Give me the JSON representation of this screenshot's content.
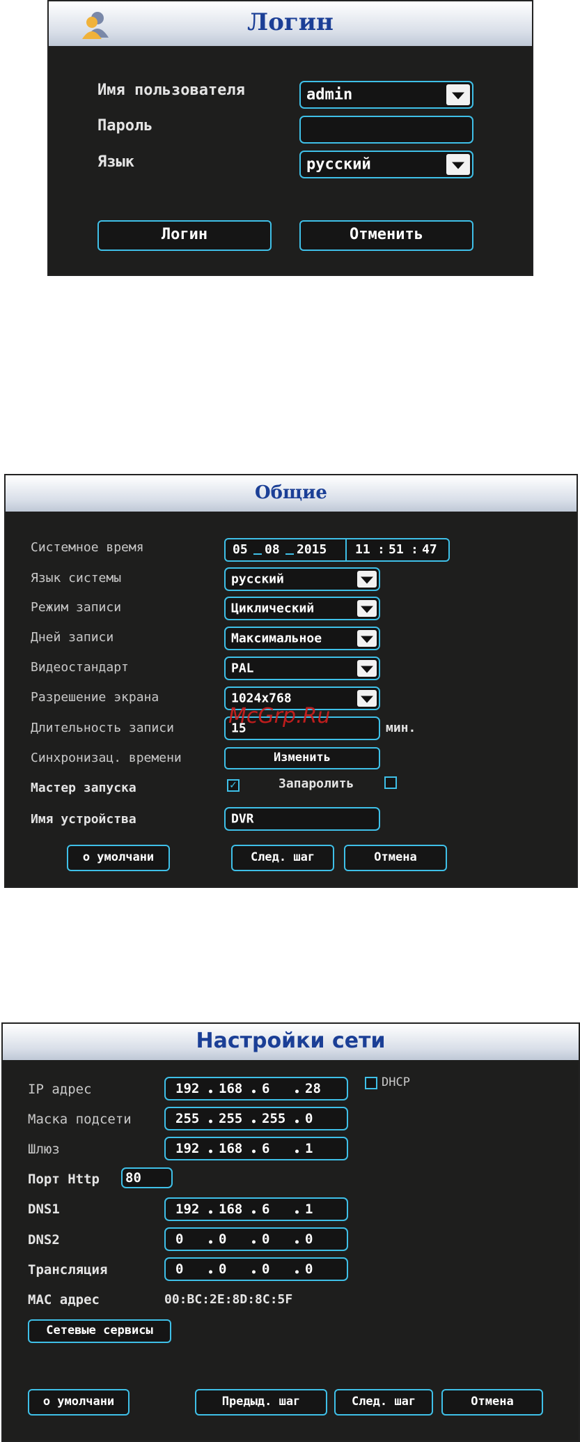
{
  "login": {
    "title": "Логин",
    "user_label": "Имя пользователя",
    "user_value": "admin",
    "password_label": "Пароль",
    "password_value": "",
    "language_label": "Язык",
    "language_value": "русский",
    "login_button": "Логин",
    "cancel_button": "Отменить"
  },
  "general": {
    "title": "Общие",
    "rows": {
      "system_time_label": "Системное время",
      "date_d": "05",
      "date_m": "08",
      "date_y": "2015",
      "time_h": "11",
      "time_m": "51",
      "time_s": "47",
      "time_sep": ":",
      "system_language_label": "Язык системы",
      "system_language_value": "русский",
      "record_mode_label": "Режим записи",
      "record_mode_value": "Циклический",
      "record_days_label": "Дней записи",
      "record_days_value": "Максимальное",
      "video_standard_label": "Видеостандарт",
      "video_standard_value": "PAL",
      "resolution_label": "Разрешение экрана",
      "resolution_value": "1024x768",
      "record_length_label": "Длительность записи",
      "record_length_value": "15",
      "record_length_unit": "мин.",
      "time_sync_label": "Синхронизац. времени",
      "time_sync_button": "Изменить",
      "startup_wizard_label": "Мастер запуска",
      "startup_wizard_checked": true,
      "password_protect_label": "Запаролить",
      "password_protect_checked": false,
      "device_name_label": "Имя устройства",
      "device_name_value": "DVR"
    },
    "buttons": {
      "default": "о умолчани",
      "next": "След. шаг",
      "cancel": "Отмена"
    },
    "watermark": "McGrp.Ru"
  },
  "network": {
    "title": "Настройки сети",
    "ip_label": "IP адрес",
    "ip": [
      "192",
      "168",
      "6",
      "28"
    ],
    "dhcp_label": "DHCP",
    "dhcp_checked": false,
    "mask_label": "Маска подсети",
    "mask": [
      "255",
      "255",
      "255",
      "0"
    ],
    "gateway_label": "Шлюз",
    "gateway": [
      "192",
      "168",
      "6",
      "1"
    ],
    "http_port_label": "Порт Http",
    "http_port_value": "80",
    "dns1_label": "DNS1",
    "dns1": [
      "192",
      "168",
      "6",
      "1"
    ],
    "dns2_label": "DNS2",
    "dns2": [
      "0",
      "0",
      "0",
      "0"
    ],
    "broadcast_label": "Трансляция",
    "broadcast": [
      "0",
      "0",
      "0",
      "0"
    ],
    "mac_label": "MAC адрес",
    "mac_value": "00:BC:2E:8D:8C:5F",
    "services_button": "Сетевые сервисы",
    "buttons": {
      "default": "о умолчани",
      "prev": "Предыд. шаг",
      "next": "След. шаг",
      "cancel": "Отмена"
    }
  },
  "colors": {
    "accent": "#3fc0e8",
    "background": "#1e1e1d",
    "title_text": "#1b3f96"
  }
}
